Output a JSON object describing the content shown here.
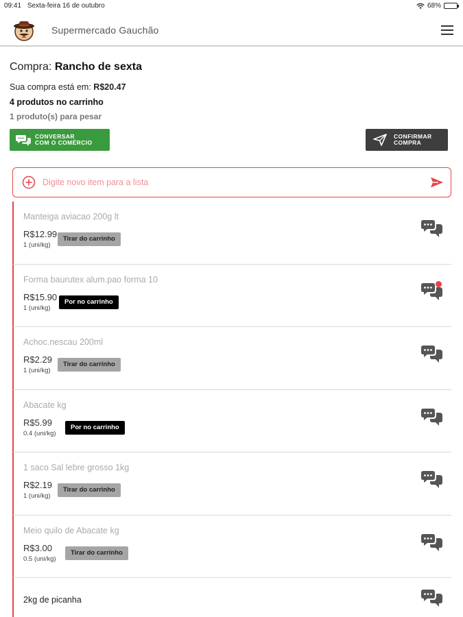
{
  "status_bar": {
    "time": "09:41",
    "date": "Sexta-feira 16 de outubro",
    "battery": "68%",
    "battery_level": 0.68
  },
  "header": {
    "store_name": "Supermercado Gauchão"
  },
  "purchase": {
    "label": "Compra:",
    "name": "Rancho de sexta",
    "total_label": "Sua compra está em:",
    "total_value": "R$20.47",
    "cart_count": "4 produtos no carrinho",
    "weigh_count": "1 produto(s) para pesar"
  },
  "actions": {
    "chat_line1": "Conversar",
    "chat_line2": "com o comércio",
    "confirm_line1": "Confirmar",
    "confirm_line2": "compra"
  },
  "new_item": {
    "placeholder": "Digite novo item para a lista",
    "value": ""
  },
  "items": [
    {
      "name": "Manteiga aviacao 200g lt",
      "price": "R$12.99",
      "qty": "1 (uni/kg)",
      "button": "Tirar do carrinho",
      "button_type": "remove",
      "has_notification": false
    },
    {
      "name": "Forma baurutex alum.pao forma 10",
      "price": "R$15.90",
      "qty": "1 (uni/kg)",
      "button": "Por no carrinho",
      "button_type": "add",
      "has_notification": true
    },
    {
      "name": "Achoc.nescau 200ml",
      "price": "R$2.29",
      "qty": "1 (uni/kg)",
      "button": "Tirar do carrinho",
      "button_type": "remove",
      "has_notification": false
    },
    {
      "name": "Abacate kg",
      "price": "R$5.99",
      "qty": "0.4 (uni/kg)",
      "button": "Por no carrinho",
      "button_type": "add",
      "has_notification": false
    },
    {
      "name": "1 saco Sal lebre grosso 1kg",
      "price": "R$2.19",
      "qty": "1 (uni/kg)",
      "button": "Tirar do carrinho",
      "button_type": "remove",
      "has_notification": false
    },
    {
      "name": "Meio quilo de Abacate kg",
      "price": "R$3.00",
      "qty": "0.5 (uni/kg)",
      "button": "Tirar do carrinho",
      "button_type": "remove",
      "has_notification": false
    },
    {
      "name": "2kg de picanha",
      "price": "",
      "qty": "",
      "button": "",
      "button_type": "none",
      "has_notification": false
    }
  ],
  "colors": {
    "accent": "#e4454a",
    "chat_green": "#3a9a3e",
    "confirm_dark": "#3e3e3e",
    "remove_gray": "#a5a5a5",
    "add_black": "#000000"
  },
  "icons": {
    "chat": "chat-bubbles-icon",
    "send": "send-arrow-icon",
    "add": "plus-circle-icon",
    "menu": "hamburger-menu-icon",
    "confirm": "paper-plane-icon"
  }
}
